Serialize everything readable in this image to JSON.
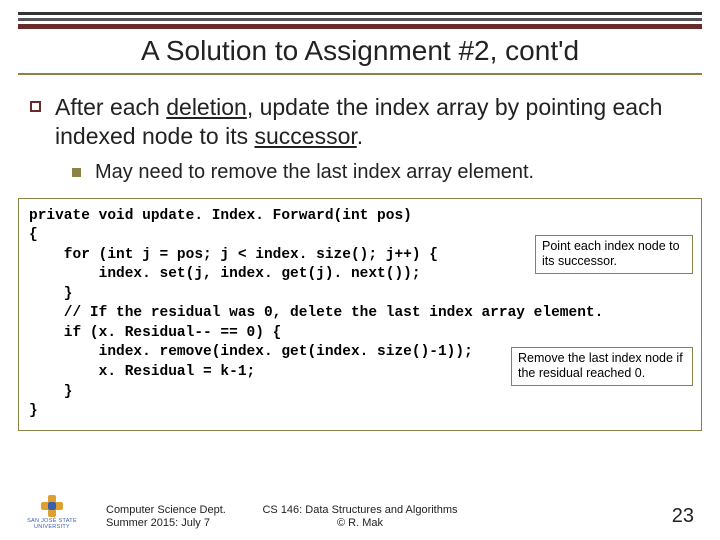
{
  "title": "A Solution to Assignment #2, cont'd",
  "bullet1": {
    "pre": "After each ",
    "u1": "deletion",
    "mid": ", update the index array by pointing each indexed node to its ",
    "u2": "successor",
    "post": "."
  },
  "bullet2": "May need to remove the last index array element.",
  "code": {
    "l1": "private void update. Index. Forward(int pos)",
    "l2": "{",
    "l3": "    for (int j = pos; j < index. size(); j++) {",
    "l4": "        index. set(j, index. get(j). next());",
    "l5": "    }",
    "l6": "",
    "l7": "    // If the residual was 0, delete the last index array element.",
    "l8": "    if (x. Residual-- == 0) {",
    "l9": "        index. remove(index. get(index. size()-1));",
    "l10": "        x. Residual = k-1;",
    "l11": "    }",
    "l12": "}"
  },
  "note1": "Point each index node to its successor.",
  "note2": "Remove the last index node if the residual reached 0.",
  "footer": {
    "left1": "Computer Science Dept.",
    "left2": "Summer 2015: July 7",
    "center1": "CS 146: Data Structures and Algorithms",
    "center2": "© R. Mak",
    "logo1": "SAN JOSÉ STATE",
    "logo2": "UNIVERSITY"
  },
  "page": "23"
}
